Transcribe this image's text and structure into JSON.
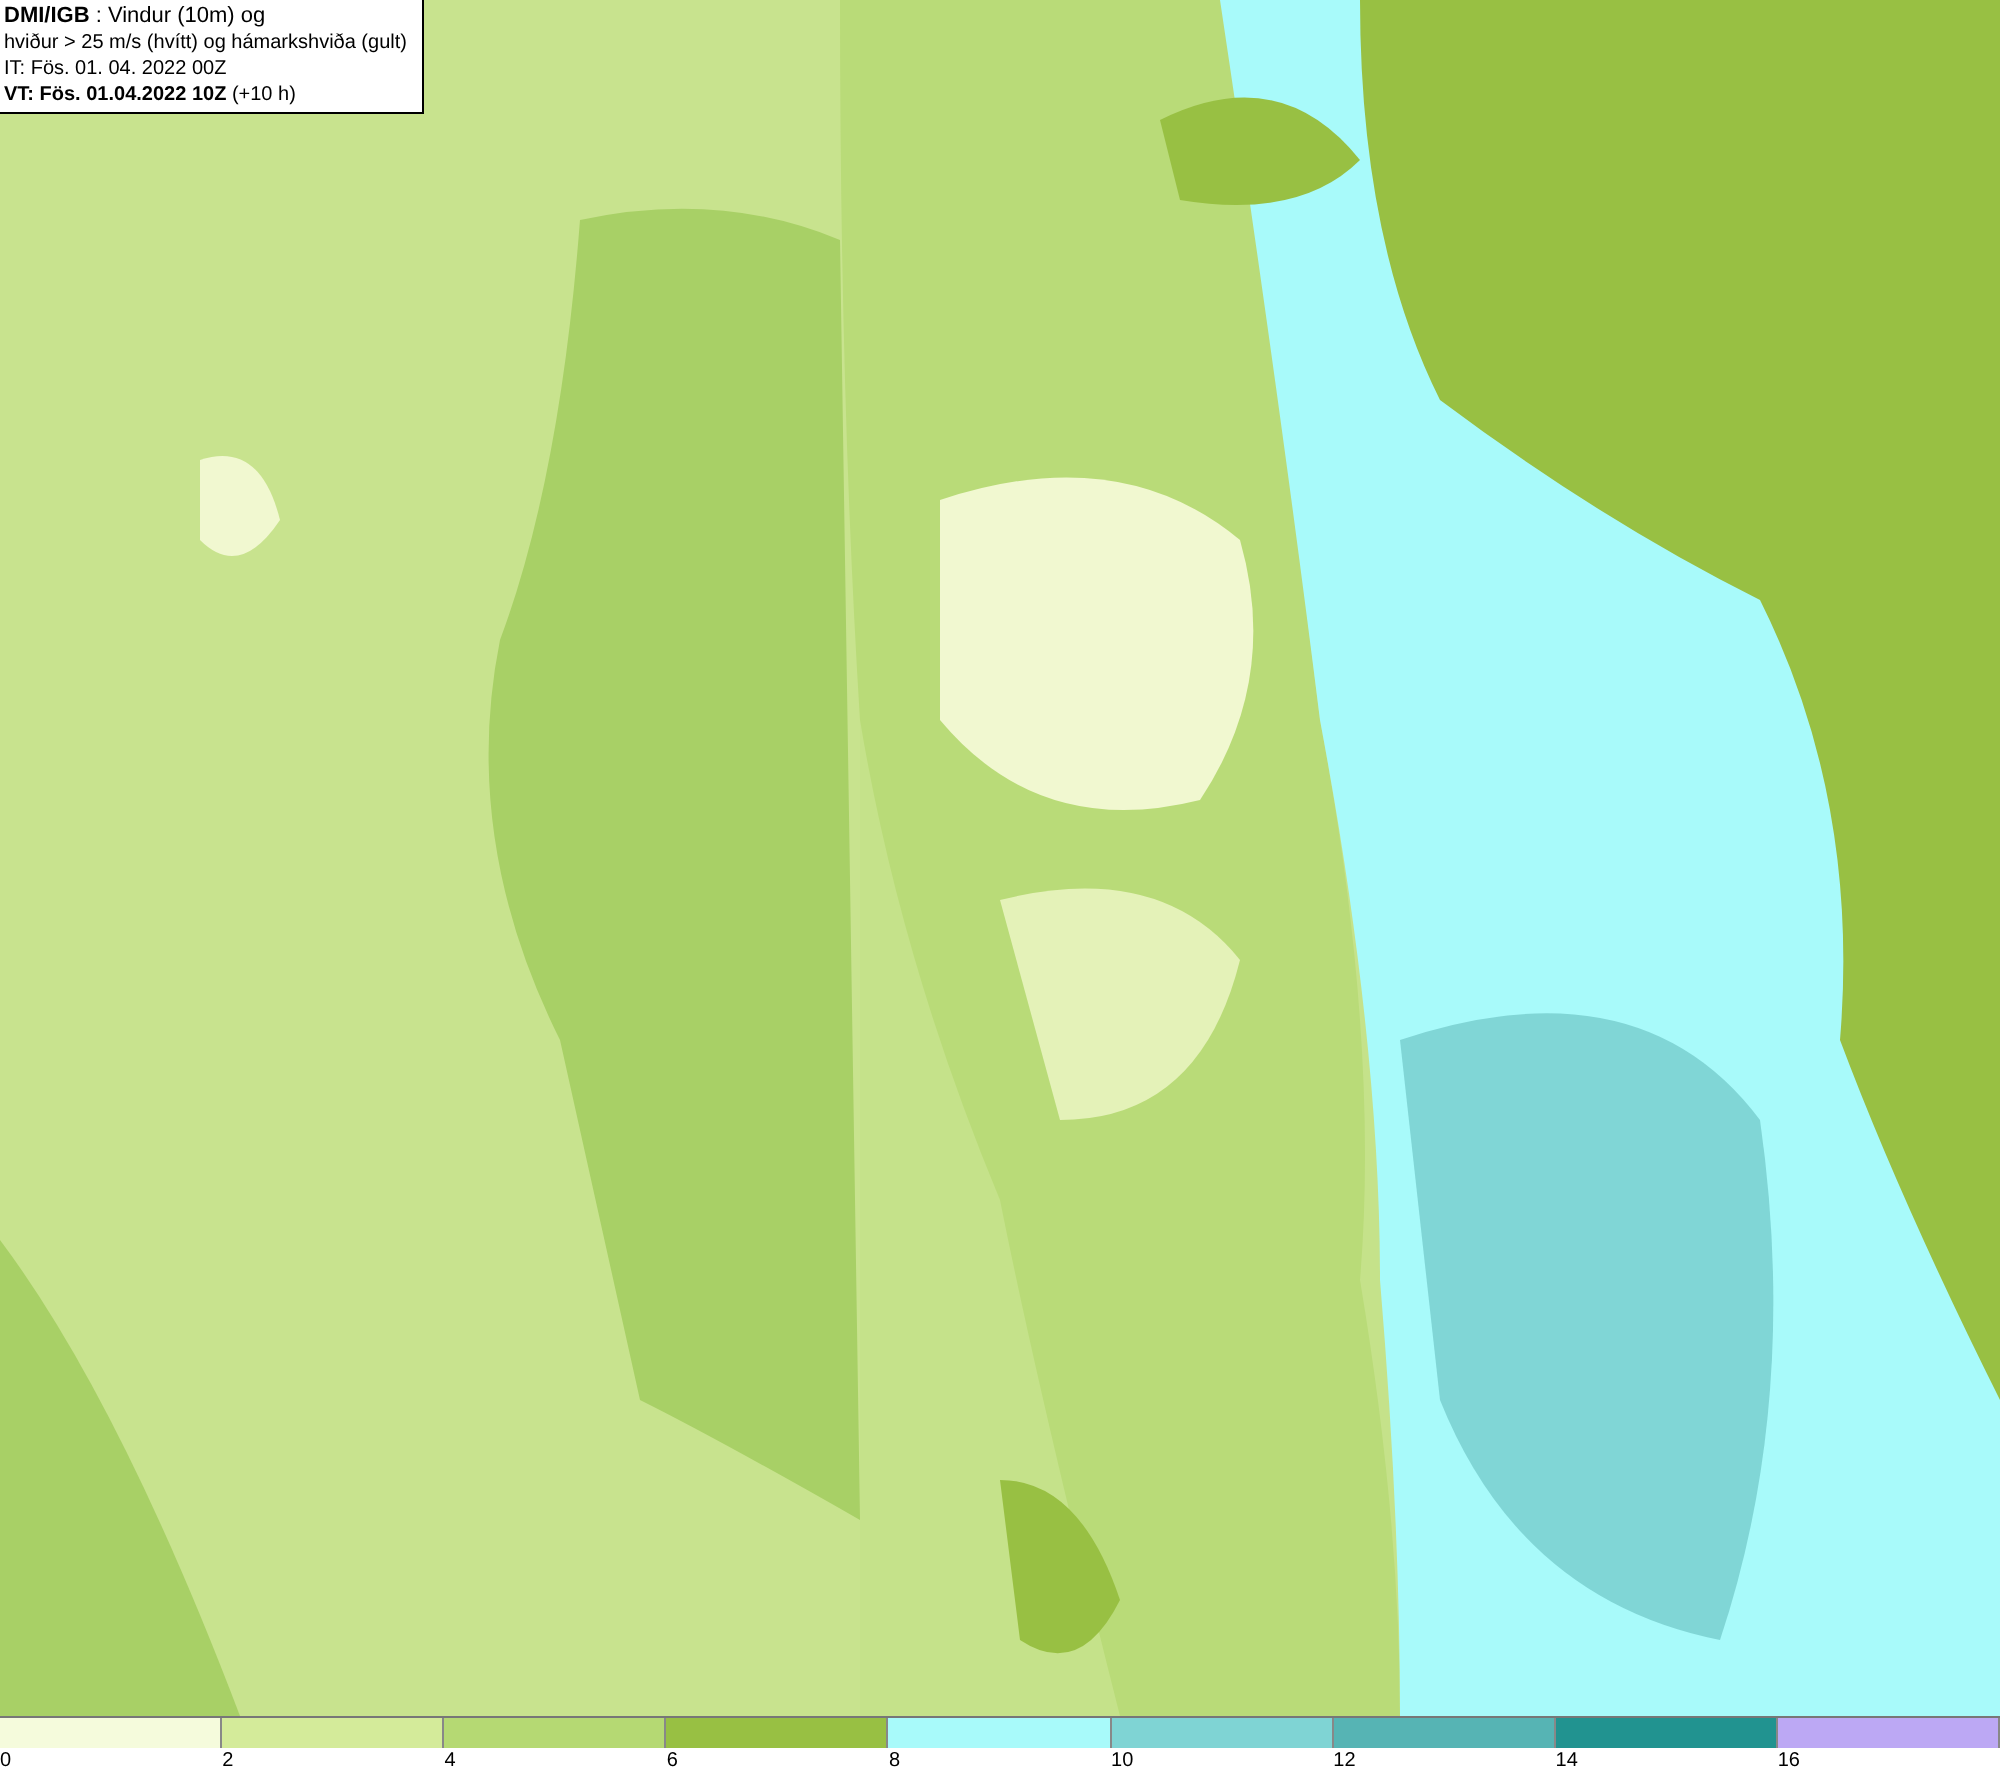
{
  "title_box": {
    "lines": [
      "**DMI/IGB** : Vindur (10m) og",
      "hviður > 25 m/s (hvítt) og hámarkshviða (gult)",
      "IT: Fös. 01. 04. 2022 00Z",
      "**VT: Fös. 01.04.2022 10Z** (+10 h)"
    ]
  },
  "legend": {
    "segments": [
      {
        "color": "#f5fbdc",
        "label": "0"
      },
      {
        "color": "#d4eb9a",
        "label": "2"
      },
      {
        "color": "#b5d973",
        "label": "4"
      },
      {
        "color": "#98c043",
        "label": "6"
      },
      {
        "color": "#a8fafa",
        "label": "8"
      },
      {
        "color": "#7fd4d4",
        "label": "10"
      },
      {
        "color": "#56b4b4",
        "label": "12"
      },
      {
        "color": "#219390",
        "label": "14"
      },
      {
        "color": "#bca8f4",
        "label": "16"
      }
    ]
  }
}
